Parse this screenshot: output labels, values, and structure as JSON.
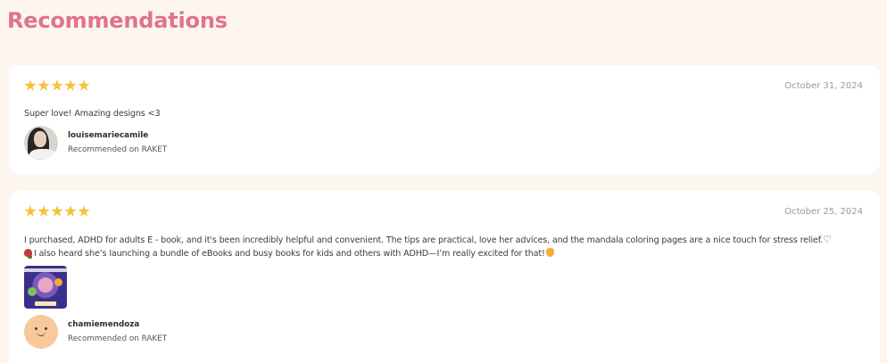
{
  "section": {
    "title": "Recommendations"
  },
  "reviews": [
    {
      "rating": 5,
      "date": "October 31, 2024",
      "text": "Super love! Amazing designs <3",
      "reviewer": {
        "name": "louisemariecamile",
        "source": "Recommended on RAKET"
      }
    },
    {
      "rating": 5,
      "date": "October 25, 2024",
      "text_line1": "I purchased, ADHD for adults E - book, and it's been incredibly helpful and convenient. The tips are practical, love her advices, and the mandala coloring pages are a nice touch for stress relief.",
      "text_line2": "I also heard she’s launching a bundle of eBooks and busy books for kids and others with ADHD—I’m really excited for that!",
      "emoji_heart": "♡",
      "reviewer": {
        "name": "chamiemendoza",
        "source": "Recommended on RAKET"
      }
    }
  ],
  "colors": {
    "accent": "#e0738a",
    "star": "#f6c234",
    "background": "#fdf6ef"
  }
}
